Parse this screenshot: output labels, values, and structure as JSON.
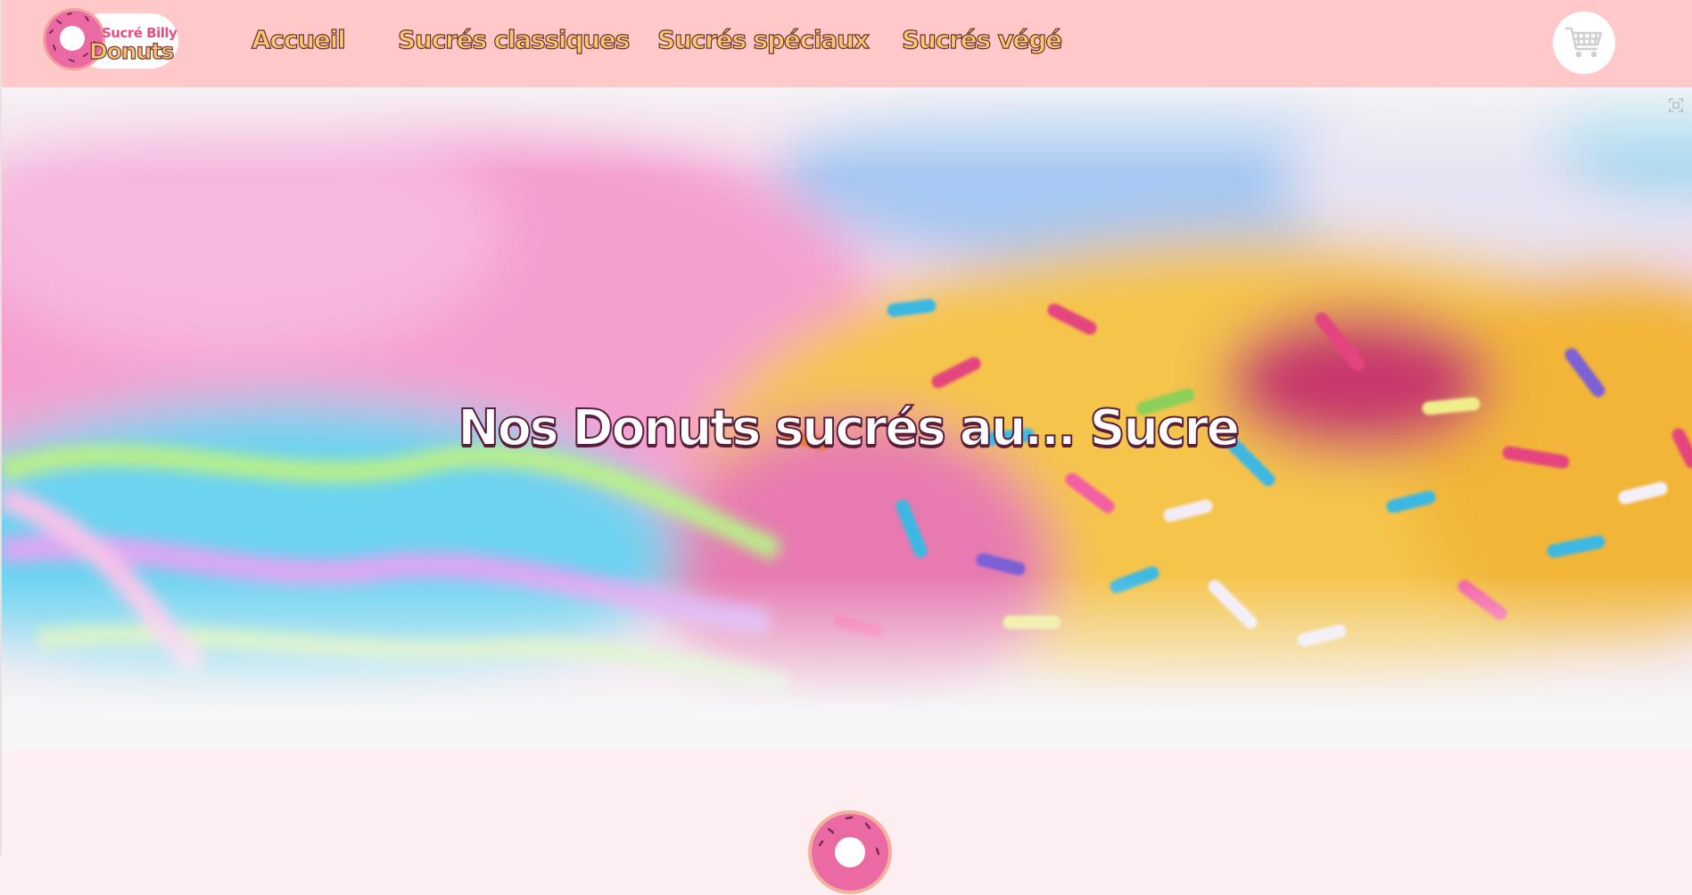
{
  "brand": {
    "name_small": "Sucré Billy",
    "name_big": "Donuts",
    "logo_icon": "donut-icon"
  },
  "nav": {
    "items": [
      {
        "label": "Accueil"
      },
      {
        "label": "Sucrés classiques"
      },
      {
        "label": "Sucrés spéciaux"
      },
      {
        "label": "Sucrés végé"
      }
    ]
  },
  "cart": {
    "icon": "shopping-cart-icon"
  },
  "hero": {
    "title": "Nos Donuts sucrés au... Sucre",
    "fullscreen_icon": "fullscreen-icon"
  },
  "colors": {
    "header_bg": "#ffc9c9",
    "nav_text": "#f8c96e",
    "nav_outline": "#6e2f2f",
    "donut_pink": "#ec6aa4",
    "section_bg": "#fdeef1"
  }
}
